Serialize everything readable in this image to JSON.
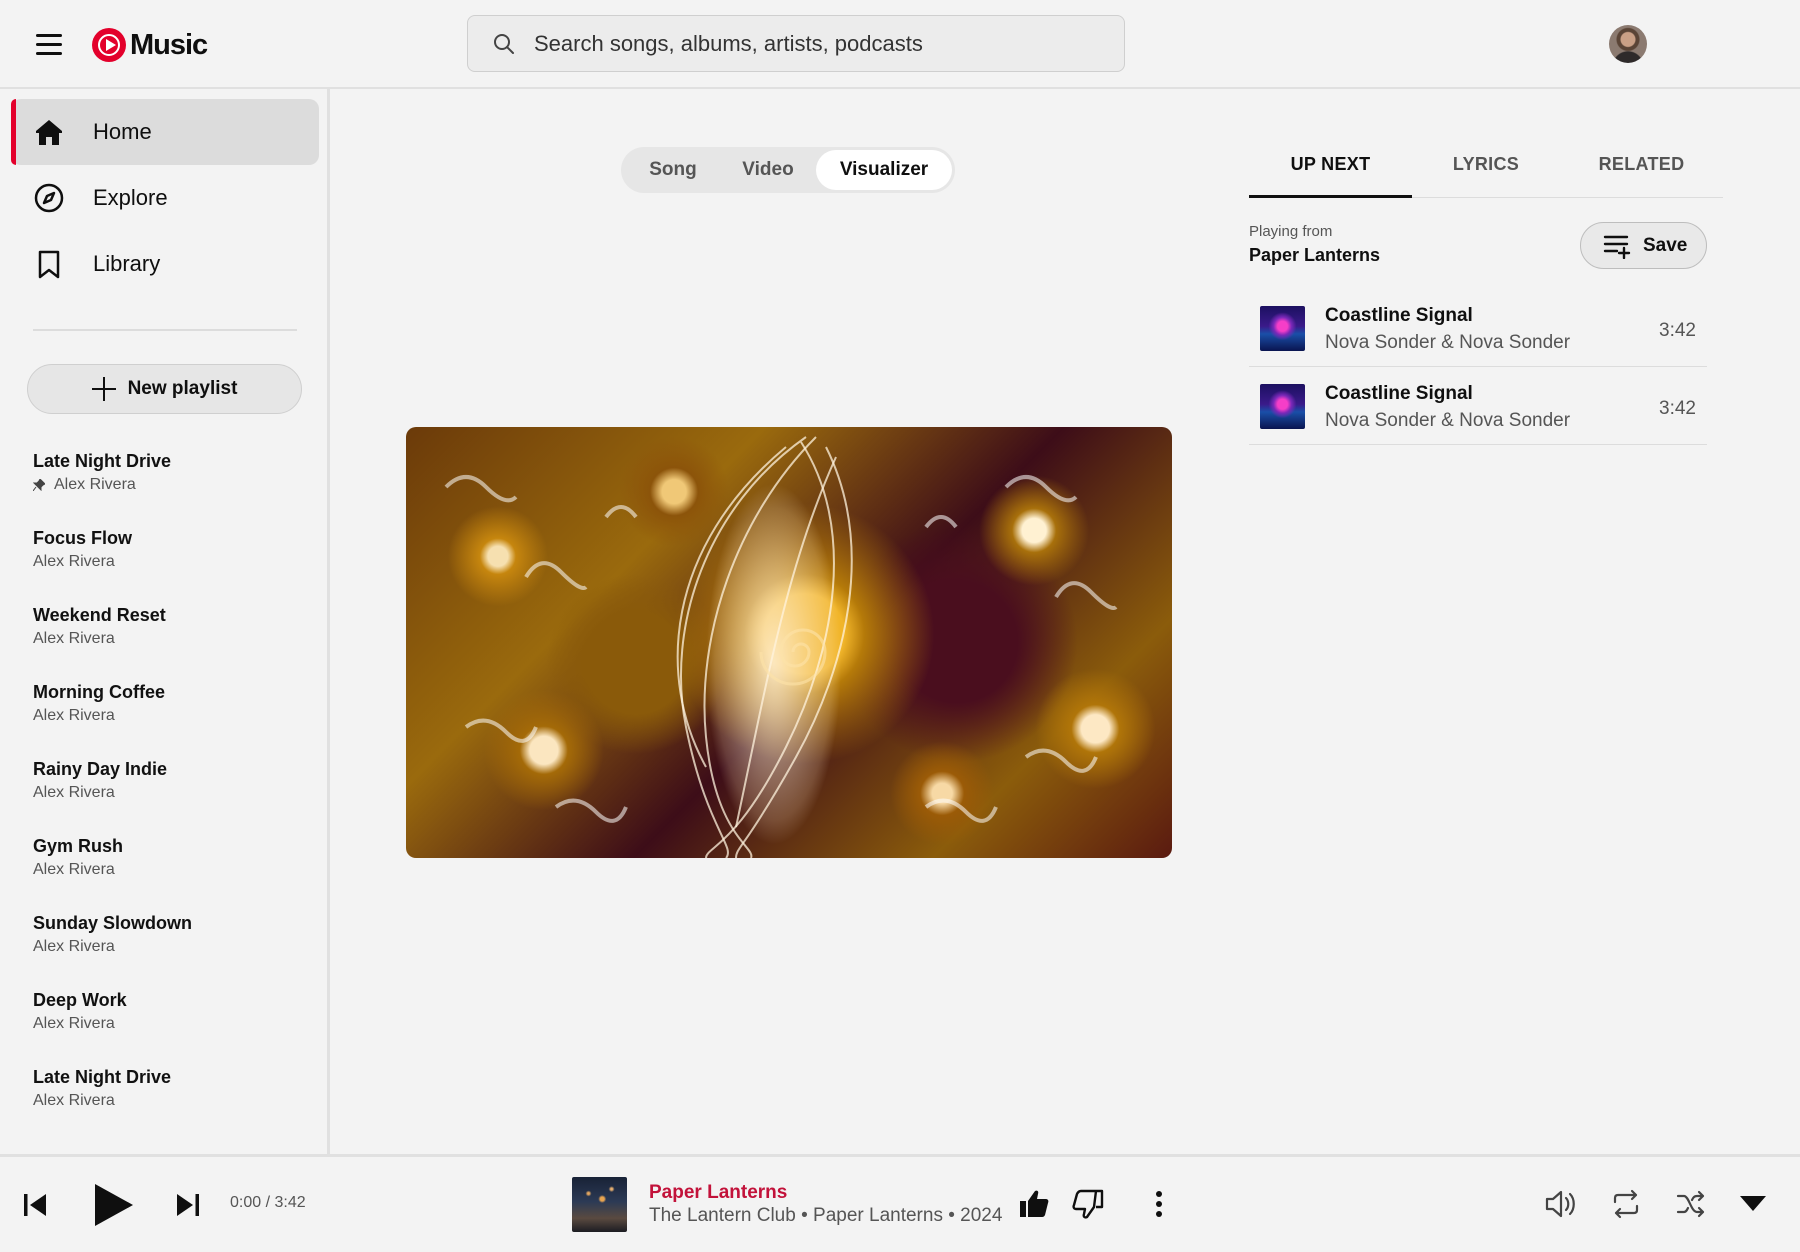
{
  "app": {
    "logo_text": "Music",
    "brand_color": "#e3002b"
  },
  "search": {
    "placeholder": "Search songs, albums, artists, podcasts"
  },
  "nav": [
    {
      "label": "Home",
      "icon": "home-icon",
      "active": true
    },
    {
      "label": "Explore",
      "icon": "compass-icon",
      "active": false
    },
    {
      "label": "Library",
      "icon": "bookmark-icon",
      "active": false
    }
  ],
  "new_playlist_label": "New playlist",
  "playlists": [
    {
      "title": "Late Night Drive",
      "owner": "Alex Rivera",
      "pinned": true
    },
    {
      "title": "Focus Flow",
      "owner": "Alex Rivera"
    },
    {
      "title": "Weekend Reset",
      "owner": "Alex Rivera"
    },
    {
      "title": "Morning Coffee",
      "owner": "Alex Rivera"
    },
    {
      "title": "Rainy Day Indie",
      "owner": "Alex Rivera"
    },
    {
      "title": "Gym Rush",
      "owner": "Alex Rivera"
    },
    {
      "title": "Sunday Slowdown",
      "owner": "Alex Rivera"
    },
    {
      "title": "Deep Work",
      "owner": "Alex Rivera"
    },
    {
      "title": "Late Night Drive",
      "owner": "Alex Rivera"
    }
  ],
  "view_toggle": {
    "options": [
      "Song",
      "Video",
      "Visualizer"
    ],
    "selected": "Visualizer"
  },
  "panel": {
    "tabs": [
      "UP NEXT",
      "LYRICS",
      "RELATED"
    ],
    "active_tab": "UP NEXT",
    "playing_from_label": "Playing from",
    "playing_from_value": "Paper Lanterns",
    "save_label": "Save",
    "queue": [
      {
        "title": "Coastline Signal",
        "artist": "Nova Sonder & Nova Sonder",
        "duration": "3:42"
      },
      {
        "title": "Coastline Signal",
        "artist": "Nova Sonder & Nova Sonder",
        "duration": "3:42"
      }
    ]
  },
  "player": {
    "time": "0:00 / 3:42",
    "title": "Paper Lanterns",
    "subtitle": "The Lantern Club • Paper Lanterns • 2024",
    "title_color": "#c2123a"
  }
}
